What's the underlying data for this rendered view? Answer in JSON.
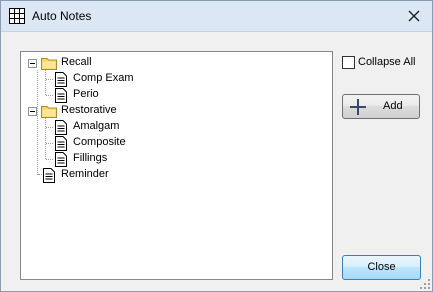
{
  "window": {
    "title": "Auto Notes",
    "icon": "grid-icon",
    "close_icon": "close-icon"
  },
  "tree": {
    "nodes": [
      {
        "label": "Recall",
        "type": "folder",
        "expanded": true
      },
      {
        "label": "Comp Exam",
        "type": "note"
      },
      {
        "label": "Perio",
        "type": "note"
      },
      {
        "label": "Restorative",
        "type": "folder",
        "expanded": true
      },
      {
        "label": "Amalgam",
        "type": "note"
      },
      {
        "label": "Composite",
        "type": "note"
      },
      {
        "label": "Fillings",
        "type": "note"
      },
      {
        "label": "Reminder",
        "type": "note"
      }
    ]
  },
  "controls": {
    "collapse_all_label": "Collapse All",
    "collapse_all_checked": false,
    "add_label": "Add",
    "add_icon": "plus-icon",
    "close_label": "Close"
  },
  "colors": {
    "titlebar": "#dbe7f5",
    "folder": "#f5d46a",
    "button_default_border": "#3c7fb1"
  }
}
